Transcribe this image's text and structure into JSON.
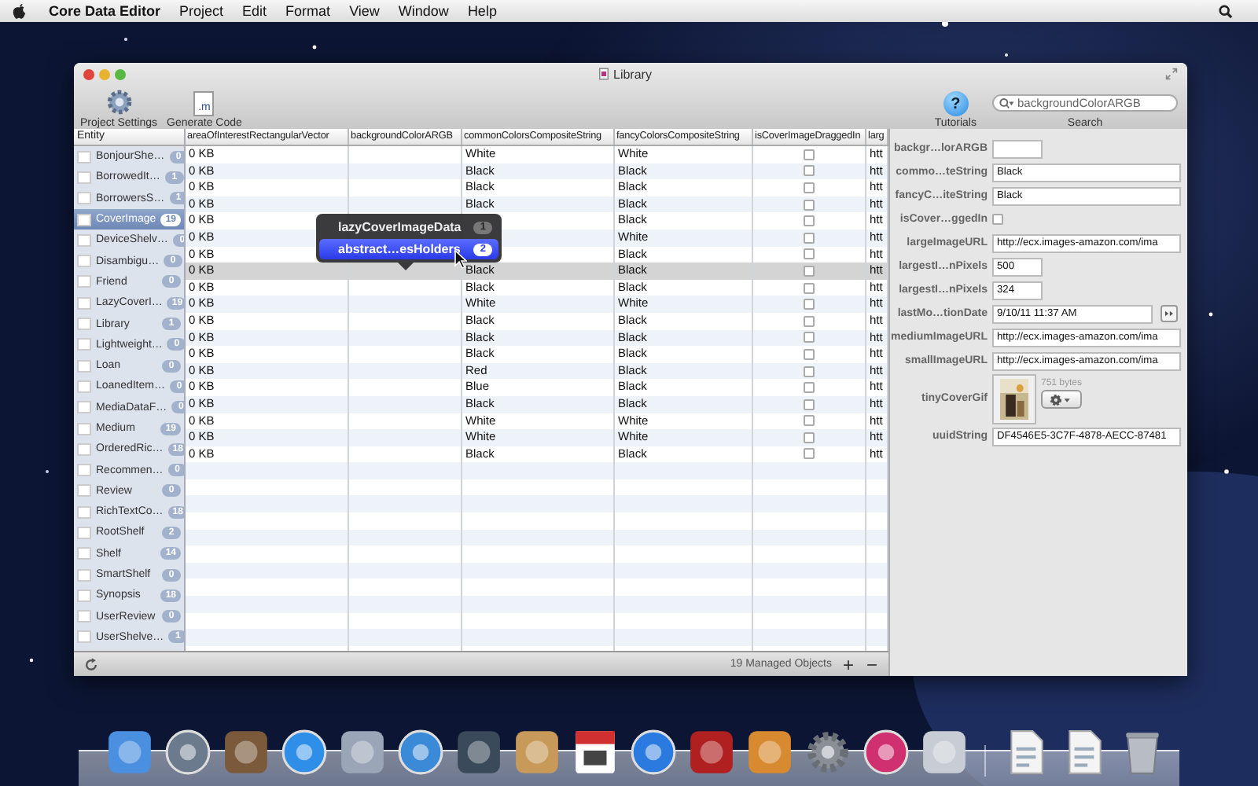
{
  "menu_bar": {
    "app": "Core Data Editor",
    "items": [
      "Project",
      "Edit",
      "Format",
      "View",
      "Window",
      "Help"
    ]
  },
  "window": {
    "title": "Library"
  },
  "toolbar": {
    "left": [
      {
        "kind": "gear",
        "label": "Project Settings"
      },
      {
        "kind": "file",
        "label": "Generate Code",
        "icon_text": ".m"
      }
    ],
    "tutorials": {
      "label": "Tutorials",
      "icon_text": "?"
    },
    "search": {
      "value": "backgroundColorARGB",
      "label": "Search"
    }
  },
  "sidebar": {
    "header": "Entity",
    "items": [
      {
        "name": "BonjourShe…",
        "count": "0",
        "selected": false
      },
      {
        "name": "BorrowedIt…",
        "count": "1",
        "selected": false
      },
      {
        "name": "BorrowersS…",
        "count": "1",
        "selected": false
      },
      {
        "name": "CoverImage",
        "count": "19",
        "selected": true
      },
      {
        "name": "DeviceShelv…",
        "count": "0",
        "selected": false
      },
      {
        "name": "Disambigu…",
        "count": "0",
        "selected": false
      },
      {
        "name": "Friend",
        "count": "0",
        "selected": false
      },
      {
        "name": "LazyCoverI…",
        "count": "19",
        "selected": false
      },
      {
        "name": "Library",
        "count": "1",
        "selected": false
      },
      {
        "name": "Lightweight…",
        "count": "0",
        "selected": false
      },
      {
        "name": "Loan",
        "count": "0",
        "selected": false
      },
      {
        "name": "LoanedItem…",
        "count": "0",
        "selected": false
      },
      {
        "name": "MediaDataF…",
        "count": "0",
        "selected": false
      },
      {
        "name": "Medium",
        "count": "19",
        "selected": false
      },
      {
        "name": "OrderedRic…",
        "count": "18",
        "selected": false
      },
      {
        "name": "Recommen…",
        "count": "0",
        "selected": false
      },
      {
        "name": "Review",
        "count": "0",
        "selected": false
      },
      {
        "name": "RichTextCo…",
        "count": "18",
        "selected": false
      },
      {
        "name": "RootShelf",
        "count": "2",
        "selected": false
      },
      {
        "name": "Shelf",
        "count": "14",
        "selected": false
      },
      {
        "name": "SmartShelf",
        "count": "0",
        "selected": false
      },
      {
        "name": "Synopsis",
        "count": "18",
        "selected": false
      },
      {
        "name": "UserReview",
        "count": "0",
        "selected": false
      },
      {
        "name": "UserShelve…",
        "count": "1",
        "selected": false
      }
    ]
  },
  "table": {
    "columns": [
      "areaOfInterestRectangularVector",
      "backgroundColorARGB",
      "commonColorsCompositeString",
      "fancyColorsCompositeString",
      "isCoverImageDraggedIn",
      "larg"
    ],
    "rows": [
      {
        "area": "0 KB",
        "common": "White",
        "fancy": "White",
        "dragged_in": false,
        "column_6": "htt",
        "selected": false
      },
      {
        "area": "0 KB",
        "common": "Black",
        "fancy": "Black",
        "dragged_in": false,
        "column_6": "htt",
        "selected": false
      },
      {
        "area": "0 KB",
        "common": "Black",
        "fancy": "Black",
        "dragged_in": false,
        "column_6": "htt",
        "selected": false
      },
      {
        "area": "0 KB",
        "common": "Black",
        "fancy": "Black",
        "dragged_in": false,
        "column_6": "htt",
        "selected": false
      },
      {
        "area": "0 KB",
        "fancy": "Black",
        "dragged_in": false,
        "column_6": "htt",
        "selected": false
      },
      {
        "area": "0 KB",
        "fancy": "White",
        "dragged_in": false,
        "column_6": "htt",
        "selected": false
      },
      {
        "area": "0 KB",
        "fancy": "Black",
        "dragged_in": false,
        "column_6": "htt",
        "selected": false
      },
      {
        "area": "0 KB",
        "common": "Black",
        "fancy": "Black",
        "dragged_in": false,
        "column_6": "htt",
        "selected": true
      },
      {
        "area": "0 KB",
        "common": "Black",
        "fancy": "Black",
        "dragged_in": false,
        "column_6": "htt",
        "selected": false
      },
      {
        "area": "0 KB",
        "common": "White",
        "fancy": "White",
        "dragged_in": false,
        "column_6": "htt",
        "selected": false
      },
      {
        "area": "0 KB",
        "common": "Black",
        "fancy": "Black",
        "dragged_in": false,
        "column_6": "htt",
        "selected": false
      },
      {
        "area": "0 KB",
        "common": "Black",
        "fancy": "Black",
        "dragged_in": false,
        "column_6": "htt",
        "selected": false
      },
      {
        "area": "0 KB",
        "common": "Black",
        "fancy": "Black",
        "dragged_in": false,
        "column_6": "htt",
        "selected": false
      },
      {
        "area": "0 KB",
        "common": "Red",
        "fancy": "Black",
        "dragged_in": false,
        "column_6": "htt",
        "selected": false
      },
      {
        "area": "0 KB",
        "common": "Blue",
        "fancy": "Black",
        "dragged_in": false,
        "column_6": "htt",
        "selected": false
      },
      {
        "area": "0 KB",
        "common": "Black",
        "fancy": "Black",
        "dragged_in": false,
        "column_6": "htt",
        "selected": false
      },
      {
        "area": "0 KB",
        "common": "White",
        "fancy": "White",
        "dragged_in": false,
        "column_6": "htt",
        "selected": false
      },
      {
        "area": "0 KB",
        "common": "White",
        "fancy": "White",
        "dragged_in": false,
        "column_6": "htt",
        "selected": false
      },
      {
        "area": "0 KB",
        "common": "Black",
        "fancy": "Black",
        "dragged_in": false,
        "column_6": "htt",
        "selected": false
      }
    ]
  },
  "popover": {
    "items": [
      {
        "label": "lazyCoverImageData",
        "count": "1",
        "selected": false
      },
      {
        "label": "abstract…esHolders",
        "count": "2",
        "selected": true
      }
    ]
  },
  "inspector": {
    "fields": [
      {
        "kind": "short",
        "label": "backgr…lorARGB"
      },
      {
        "kind": "text",
        "label": "commo…teString",
        "value": "Black"
      },
      {
        "kind": "text",
        "label": "fancyC…iteString",
        "value": "Black"
      },
      {
        "kind": "checkbox",
        "label": "isCover…ggedIn",
        "checked": false
      },
      {
        "kind": "text",
        "label": "largeImageURL",
        "value": "http://ecx.images-amazon.com/ima"
      },
      {
        "kind": "short",
        "label": "largestI…nPixels",
        "value": "500"
      },
      {
        "kind": "short",
        "label": "largestI…nPixels",
        "value": "324"
      },
      {
        "kind": "date",
        "label": "lastMo…tionDate",
        "value": "9/10/11 11:37 AM"
      },
      {
        "kind": "text",
        "label": "mediumImageURL",
        "value": "http://ecx.images-amazon.com/ima"
      },
      {
        "kind": "text",
        "label": "smallImageURL",
        "value": "http://ecx.images-amazon.com/ima"
      },
      {
        "label": "tinyCoverGif",
        "size_text": "751 bytes"
      },
      {
        "kind": "text",
        "label": "uuidString",
        "value": "DF4546E5-3C7F-4878-AECC-87481"
      }
    ]
  },
  "status_bar": {
    "text": "19 Managed Objects",
    "add": "+",
    "remove": "−"
  }
}
